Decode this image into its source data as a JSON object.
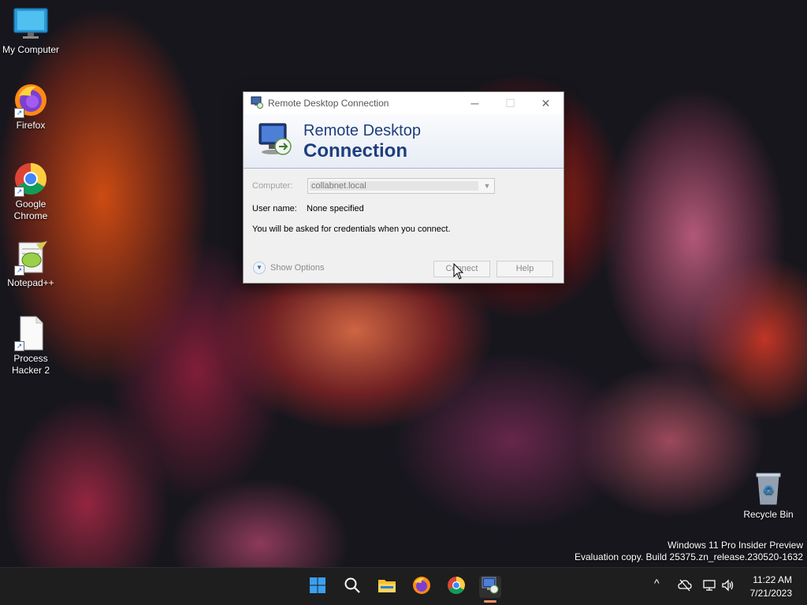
{
  "desktop": {
    "icons": [
      {
        "label": "My Computer"
      },
      {
        "label": "Firefox"
      },
      {
        "label": "Google\nChrome"
      },
      {
        "label": "Notepad++"
      },
      {
        "label": "Process\nHacker 2"
      },
      {
        "label": "Recycle Bin"
      }
    ],
    "watermark_line1": "Windows 11 Pro Insider Preview",
    "watermark_line2": "Evaluation copy. Build 25375.zn_release.230520-1632"
  },
  "dialog": {
    "title": "Remote Desktop Connection",
    "banner_line1": "Remote Desktop",
    "banner_line2": "Connection",
    "computer_label": "Computer:",
    "computer_value": "collabnet.local",
    "username_label": "User name:",
    "username_value": "None specified",
    "info_text": "You will be asked for credentials when you connect.",
    "show_options_label": "Show Options",
    "connect_label": "Connect",
    "help_label": "Help",
    "minimize_glyph": "─",
    "maximize_glyph": "☐",
    "close_glyph": "✕"
  },
  "taskbar": {
    "items": [
      "start",
      "search",
      "file-explorer",
      "firefox",
      "chrome",
      "remote-desktop-connection"
    ],
    "time": "11:22 AM",
    "date": "7/21/2023",
    "tray_chevron": "^"
  },
  "colors": {
    "banner_text": "#1d3f7d",
    "taskbar_bg": "#1e1e1e",
    "active_indicator": "#ff8f6b",
    "wallpaper_base": "#17161d"
  }
}
